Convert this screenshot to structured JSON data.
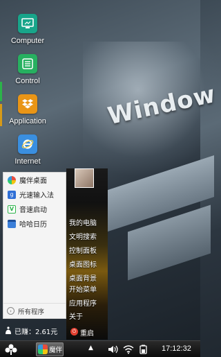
{
  "desktop": {
    "wallpaper_text": "Window",
    "icons": [
      {
        "label": "Computer",
        "icon": "monitor-icon",
        "color": "#18a58a"
      },
      {
        "label": "Control",
        "icon": "control-panel-icon",
        "color": "#27b060"
      },
      {
        "label": "Application",
        "icon": "dropbox-icon",
        "color": "#e99516"
      },
      {
        "label": "Internet",
        "icon": "ie-icon",
        "color": "#3a8fe0"
      }
    ]
  },
  "start_menu": {
    "left_items": [
      {
        "label": "魔伴桌面",
        "icon": "pinwheel-icon"
      },
      {
        "label": "光速输入法",
        "icon": "keyboard-icon"
      },
      {
        "label": "音速启动",
        "icon": "launcher-icon"
      },
      {
        "label": "哈哈日历",
        "icon": "calendar-icon"
      }
    ],
    "all_programs": "所有程序",
    "earnings": "已赚：2.61元",
    "right_items": [
      {
        "label": "我的电脑"
      },
      {
        "label": "文明搜索"
      },
      {
        "label": "控制面板"
      },
      {
        "label": "桌面图标"
      },
      {
        "label": "桌面背景"
      },
      {
        "label": "开始菜单"
      },
      {
        "label": "应用程序"
      },
      {
        "label": "关于"
      }
    ],
    "shutdown": "重启"
  },
  "taskbar": {
    "app_label": "魔伴",
    "clock": "17:12:32"
  },
  "colors": {
    "accent": "#2cb34a",
    "taskbar": "#111111"
  }
}
